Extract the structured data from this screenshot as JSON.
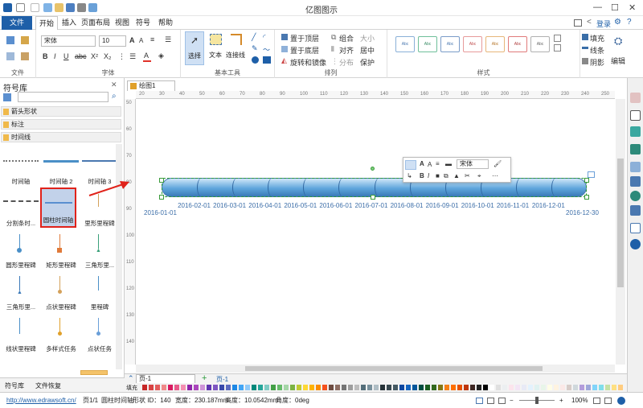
{
  "app": {
    "title": "亿图图示"
  },
  "menu": {
    "file": "文件",
    "items": [
      "开始",
      "插入",
      "页面布局",
      "视图",
      "符号",
      "帮助"
    ],
    "login": "登录"
  },
  "ribbon": {
    "font_name": "宋体",
    "font_size": "10",
    "group_file": "文件",
    "group_font": "字体",
    "group_tools": "基本工具",
    "group_arrange": "排列",
    "group_styles": "样式",
    "select": "选择",
    "text": "文本",
    "connector": "连接线",
    "to_top": "置于顶层",
    "to_bottom": "置于底层",
    "rotate_mirror": "旋转和镜像",
    "group": "组合",
    "align": "对齐",
    "distribute": "分布",
    "size": "大小",
    "center": "居中",
    "protect": "保护",
    "fill": "填充",
    "line": "线条",
    "shadow": "阴影",
    "edit": "编辑",
    "style_sample": "Abc"
  },
  "library": {
    "title": "符号库",
    "categories": [
      "箭头形状",
      "标注",
      "时间线"
    ],
    "shapes": [
      "时间轴",
      "时间轴 2",
      "时间轴 3",
      "分割条时...",
      "圆柱时间轴",
      "里形里程碑",
      "圆形里程碑",
      "矩形里程碑",
      "三角形里...",
      "三角形里...",
      "点状里程碑",
      "里程碑",
      "线状里程碑",
      "多样式任务",
      "点状任务"
    ],
    "bottom_tabs": [
      "符号库",
      "文件恢复"
    ]
  },
  "document": {
    "tab": "绘图1"
  },
  "ruler": {
    "h": [
      "20",
      "30",
      "40",
      "50",
      "60",
      "70",
      "80",
      "90",
      "100",
      "110",
      "120",
      "130",
      "140",
      "150",
      "160",
      "170",
      "180",
      "190",
      "200",
      "210",
      "220",
      "230",
      "240",
      "250"
    ],
    "v": [
      "50",
      "60",
      "70",
      "80",
      "90",
      "100",
      "110",
      "120",
      "130",
      "140"
    ]
  },
  "float_toolbar": {
    "font": "宋体"
  },
  "timeline": {
    "start": "2016-01-01",
    "end": "2016-12-30",
    "months": [
      "2016-02-01",
      "2016-03-01",
      "2016-04-01",
      "2016-05-01",
      "2016-06-01",
      "2016-07-01",
      "2016-08-01",
      "2016-09-01",
      "2016-10-01",
      "2016-11-01",
      "2016-12-01"
    ]
  },
  "pages": {
    "current": "页-1",
    "tab": "页-1",
    "fill_label": "填充"
  },
  "status": {
    "url": "http://www.edrawsoft.cn/",
    "page": "页1/1",
    "shape": "圆柱时间轴",
    "shape_id": "形状 ID：140",
    "width": "宽度：230.187mm",
    "height": "高度：10.0542mm",
    "angle": "角度：0deg",
    "zoom": "100%"
  }
}
